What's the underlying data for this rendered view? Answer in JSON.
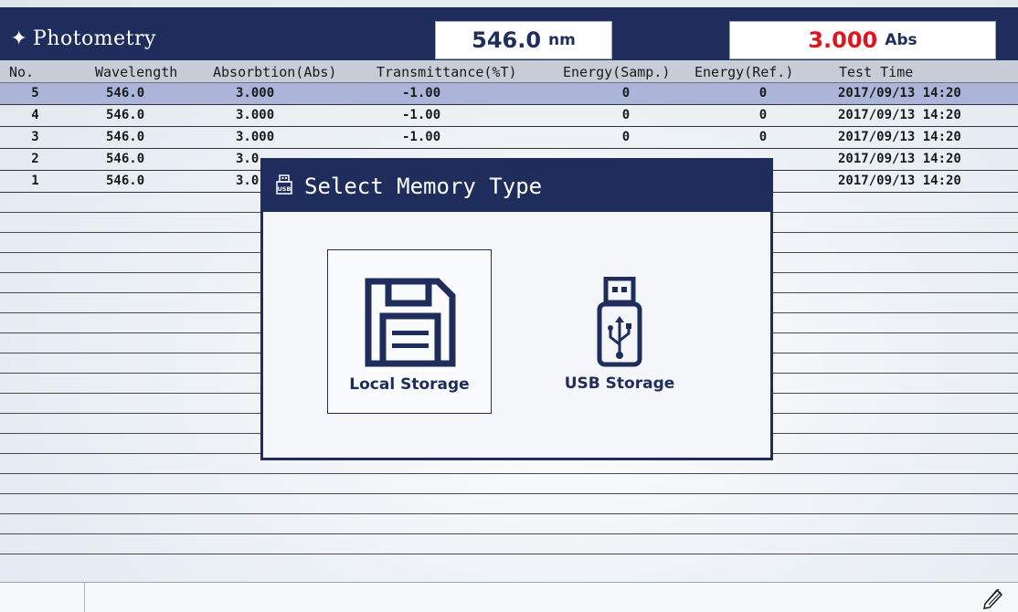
{
  "header": {
    "title": "Photometry",
    "sun_icon": "✦",
    "wavelength_value": "546.0",
    "wavelength_unit": "nm",
    "absorbance_value": "3.000",
    "absorbance_unit": "Abs"
  },
  "table": {
    "columns": [
      "No.",
      "Wavelength",
      "Absorbtion(Abs)",
      "Transmittance(%T)",
      "Energy(Samp.)",
      "Energy(Ref.)",
      "Test Time"
    ],
    "rows": [
      {
        "no": "5",
        "wl": "546.0",
        "abs": "3.000",
        "tr": "-1.00",
        "es": "0",
        "er": "0",
        "time": "2017/09/13 14:20"
      },
      {
        "no": "4",
        "wl": "546.0",
        "abs": "3.000",
        "tr": "-1.00",
        "es": "0",
        "er": "0",
        "time": "2017/09/13 14:20"
      },
      {
        "no": "3",
        "wl": "546.0",
        "abs": "3.000",
        "tr": "-1.00",
        "es": "0",
        "er": "0",
        "time": "2017/09/13 14:20"
      },
      {
        "no": "2",
        "wl": "546.0",
        "abs": "3.0",
        "tr": "",
        "es": "",
        "er": "",
        "time": "2017/09/13 14:20"
      },
      {
        "no": "1",
        "wl": "546.0",
        "abs": "3.0",
        "tr": "",
        "es": "",
        "er": "",
        "time": "2017/09/13 14:20"
      }
    ]
  },
  "dialog": {
    "title": "Select Memory Type",
    "options": {
      "local": "Local Storage",
      "usb": "USB Storage"
    }
  },
  "colors": {
    "navy": "#1f2d5c",
    "red": "#e0141e",
    "selected_row": "#aab5d9"
  }
}
